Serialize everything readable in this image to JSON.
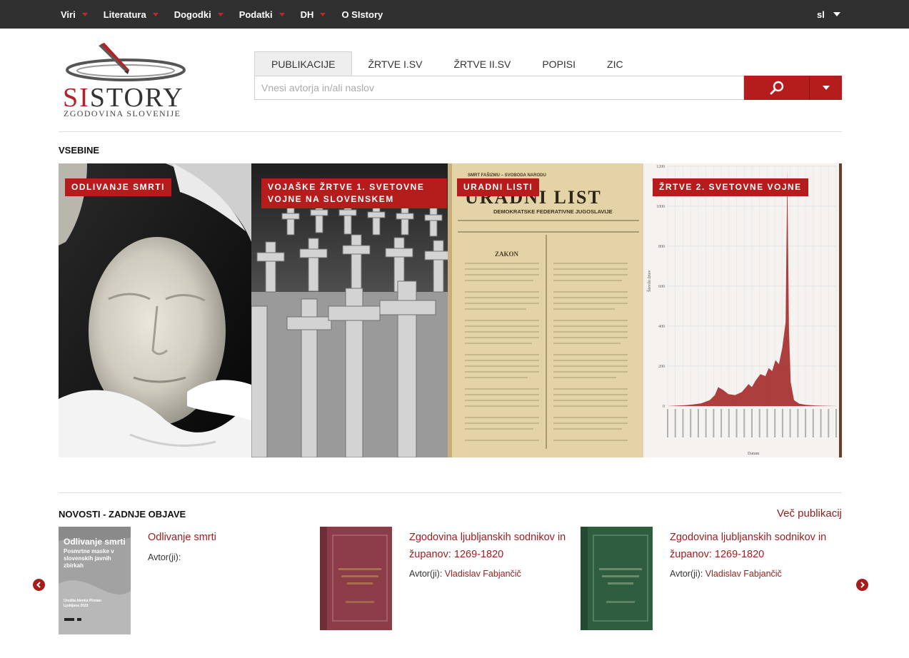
{
  "topnav": {
    "items": [
      {
        "label": "Viri",
        "has_dropdown": true
      },
      {
        "label": "Literatura",
        "has_dropdown": true
      },
      {
        "label": "Dogodki",
        "has_dropdown": true
      },
      {
        "label": "Podatki",
        "has_dropdown": true
      },
      {
        "label": "DH",
        "has_dropdown": true
      },
      {
        "label": "O SIstory",
        "has_dropdown": false
      }
    ],
    "language": "sl"
  },
  "logo": {
    "brand_accent": "SI",
    "brand_rest": "STORY",
    "tagline": "ZGODOVINA SLOVENIJE"
  },
  "search": {
    "tabs": [
      "PUBLIKACIJE",
      "ŽRTVE I.SV",
      "ŽRTVE II.SV",
      "POPISI",
      "ZIC"
    ],
    "active_tab": "PUBLIKACIJE",
    "placeholder": "Vnesi avtorja in/ali naslov",
    "value": "",
    "button_icon": "search-icon"
  },
  "contents": {
    "title": "VSEBINE",
    "tiles": [
      {
        "label": "ODLIVANJE SMRTI"
      },
      {
        "label": "VOJAŠKE ŽRTVE 1. SVETOVNE VOJNE NA SLOVENSKEM"
      },
      {
        "label": "URADNI LISTI"
      },
      {
        "label": "ŽRTVE 2. SVETOVNE VOJNE"
      }
    ],
    "newspaper": {
      "masthead": "URADNI LIST",
      "small_header": "SMRT FAŠIZMU – SVOBODA NARODU",
      "subheader": "DEMOKRATSKE FEDERATIVNE JUGOSLAVIJE",
      "section": "ZAKON"
    },
    "war_chart": {
      "y_ticks": [
        "1200",
        "1000",
        "800",
        "600",
        "400",
        "200",
        "0"
      ],
      "ylabel": "Število žrtev",
      "xlabel": "Datum",
      "color": "#a52a2a"
    }
  },
  "news": {
    "title": "NOVOSTI - ZADNJE OBJAVE",
    "more_label": "Več publikacij",
    "author_prefix": "Avtor(ji):",
    "items": [
      {
        "title": "Odlivanje smrti",
        "author": "",
        "cover": {
          "title": "Odlivanje smrti",
          "subtitle": "Posmrtne maske v slovenskih javnih zbirkah",
          "editor": "Uredila Alenka Pirman",
          "place_year": "Ljubljana 2023"
        }
      },
      {
        "title": "Zgodovina ljubljanskih sodnikov in županov: 1269-1820",
        "author": "Vladislav Fabjančič",
        "cover": {
          "color": "#8a3a48"
        }
      },
      {
        "title": "Zgodovina ljubljanskih sodnikov in županov: 1269-1820",
        "author": "Vladislav Fabjančič",
        "cover": {
          "color": "#2f5e41"
        }
      }
    ]
  },
  "colors": {
    "topbar": "#303030",
    "accent": "#b51c1c",
    "link": "#9b1c1c"
  }
}
